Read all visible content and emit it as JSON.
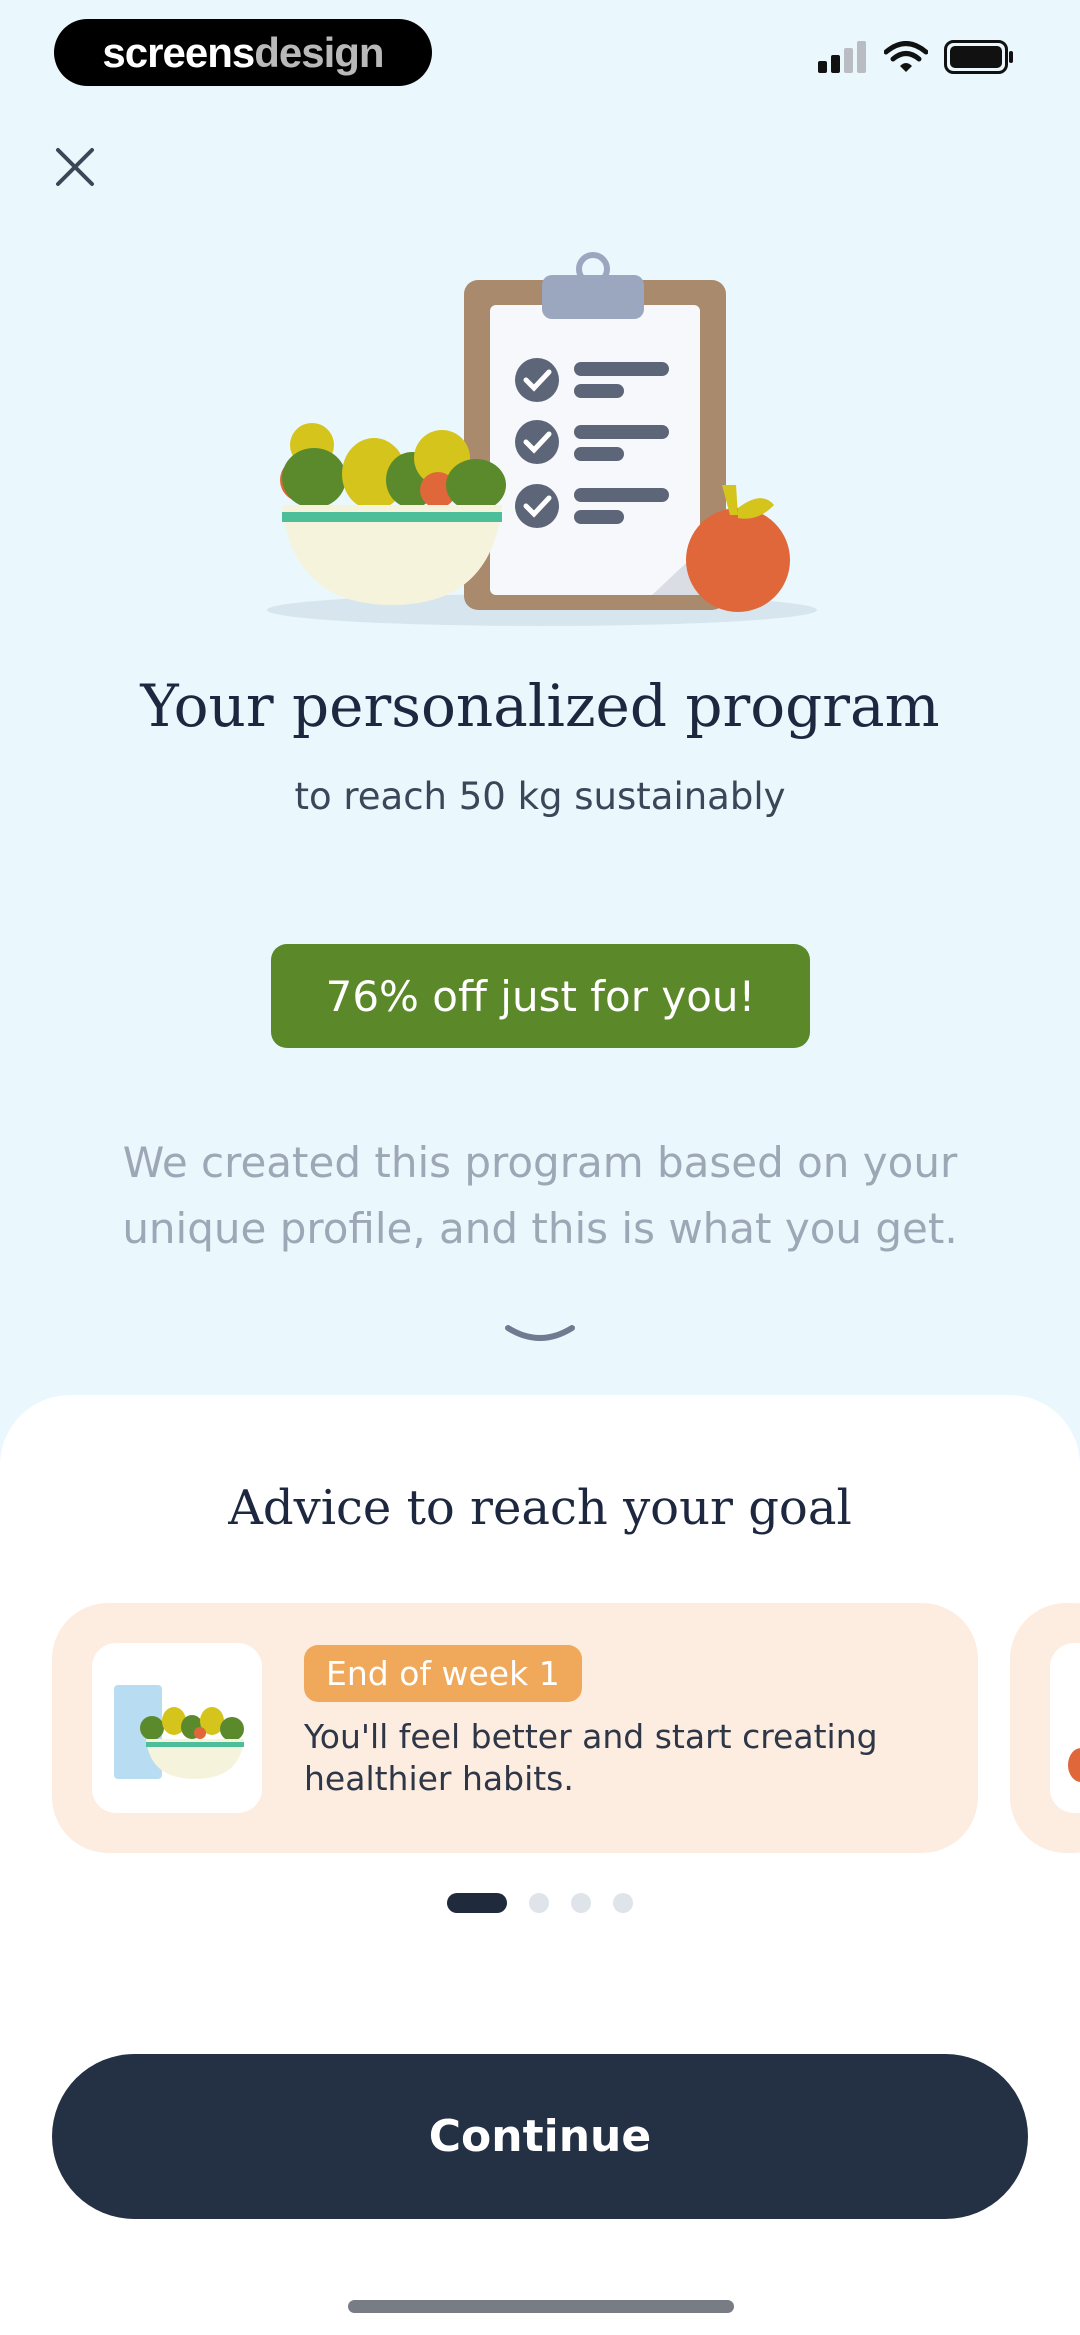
{
  "status_bar": {
    "brand_part1": "screens",
    "brand_part2": "design",
    "icons": [
      "signal-icon",
      "wifi-icon",
      "battery-icon"
    ]
  },
  "header": {
    "close_icon": "close-icon"
  },
  "hero": {
    "illustration": "clipboard-salad-apple-illustration",
    "title": "Your personalized program",
    "subtitle": "to reach 50 kg sustainably",
    "discount_label": "76% off just for you!",
    "description": "We created this program based on your unique profile, and this is what you get.",
    "chevron_icon": "chevron-down-icon"
  },
  "advice": {
    "title": "Advice to reach your goal",
    "cards": [
      {
        "badge": "End of week 1",
        "text": "You'll feel better and start creating healthier habits.",
        "image": "salad-water-illustration"
      }
    ],
    "pagination": {
      "total": 4,
      "active": 0
    }
  },
  "footer": {
    "continue_label": "Continue"
  },
  "colors": {
    "background": "#eaf7fd",
    "discount_green": "#5b8829",
    "badge_orange": "#f0a95a",
    "card_peach": "#fdece0",
    "button_navy": "#243044"
  }
}
